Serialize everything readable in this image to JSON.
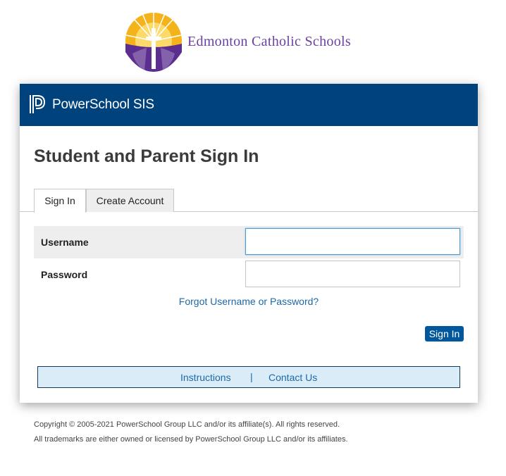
{
  "logo": {
    "text": "Edmonton Catholic Schools",
    "icon": "sunburst-cross-logo",
    "colors": {
      "sun": "#f5b31b",
      "sun_core": "#fbd96a",
      "purple": "#5b2e8f"
    }
  },
  "banner": {
    "brand": "PowerSchool SIS",
    "icon": "powerschool-logo-icon",
    "color": "#00427c"
  },
  "page": {
    "title": "Student and Parent Sign In"
  },
  "tabs": [
    {
      "label": "Sign In",
      "active": true
    },
    {
      "label": "Create Account",
      "active": false
    }
  ],
  "form": {
    "username_label": "Username",
    "username_value": "",
    "password_label": "Password",
    "password_value": "",
    "forgot_link": "Forgot Username or Password?",
    "submit_label": "Sign In"
  },
  "footer": {
    "instructions": "Instructions",
    "separator": "|",
    "contact": "Contact Us"
  },
  "copyright": {
    "line1": "Copyright © 2005-2021 PowerSchool Group LLC and/or its affiliate(s). All rights reserved.",
    "line2": "All trademarks are either owned or licensed by PowerSchool Group LLC and/or its affiliates."
  }
}
